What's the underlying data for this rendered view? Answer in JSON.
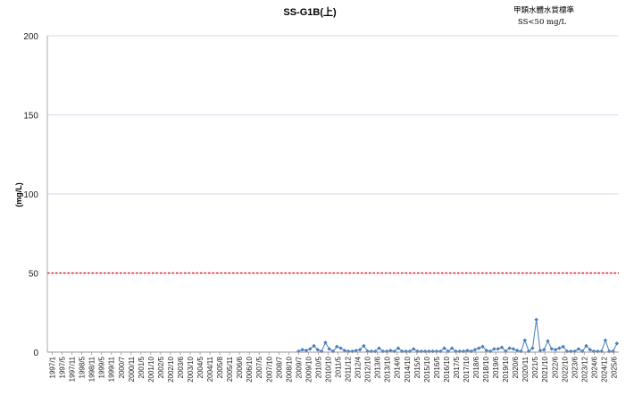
{
  "chart_data": {
    "type": "line",
    "title": "SS-G1B(上)",
    "standard_line1": "甲類水體水質標準",
    "standard_line2": "SS<50 mg/L",
    "xlabel": "",
    "ylabel": "(mg/L)",
    "ylim": [
      0,
      200
    ],
    "yticks": [
      0,
      50,
      100,
      150,
      200
    ],
    "grid": true,
    "legend": "none",
    "standard_value": 50,
    "standard_color": "#e02020",
    "series_color": "#4a7ebb",
    "grid_color": "#c8cde8",
    "x_ticks": [
      "1997/1",
      "1997/5",
      "1997/11",
      "1998/5",
      "1998/11",
      "1999/5",
      "1999/11",
      "2000/7",
      "2000/11",
      "2001/5",
      "2001/10",
      "2002/5",
      "2002/10",
      "2003/6",
      "2003/10",
      "2004/5",
      "2004/11",
      "2005/8",
      "2005/11",
      "2006/6",
      "2006/10",
      "2007/5",
      "2007/10",
      "2008/7",
      "2008/10",
      "2009/7",
      "2009/10",
      "2010/5",
      "2010/10",
      "2011/5",
      "2011/12",
      "2012/4",
      "2012/10",
      "2013/6",
      "2013/10",
      "2014/6",
      "2014/10",
      "2015/5",
      "2015/10",
      "2016/5",
      "2016/10",
      "2017/5",
      "2017/10",
      "2018/6",
      "2018/10",
      "2019/6",
      "2019/10",
      "2020/6",
      "2020/11",
      "2021/5",
      "2021/10",
      "2022/6",
      "2022/10",
      "2023/6",
      "2023/12",
      "2024/6",
      "2024/12",
      "2025/6"
    ],
    "values": [
      null,
      null,
      null,
      null,
      null,
      null,
      null,
      null,
      null,
      null,
      null,
      null,
      null,
      null,
      null,
      null,
      null,
      null,
      null,
      null,
      null,
      null,
      null,
      null,
      null,
      null,
      null,
      null,
      null,
      null,
      null,
      null,
      null,
      null,
      null,
      null,
      null,
      null,
      null,
      null,
      null,
      null,
      null,
      null,
      null,
      null,
      null,
      null,
      null,
      null,
      null,
      null,
      null,
      null,
      null,
      null,
      null,
      null,
      null,
      null,
      null,
      null,
      null,
      null,
      null,
      0.5,
      1.5,
      1.0,
      2.0,
      4.0,
      1.5,
      0.5,
      6.0,
      2.0,
      0.5,
      3.5,
      2.5,
      1.0,
      0.5,
      0.5,
      1.0,
      1.5,
      4.0,
      0.5,
      0.5,
      0.5,
      2.5,
      0.5,
      0.5,
      1.0,
      0.5,
      2.5,
      0.5,
      0.5,
      0.5,
      2.0,
      0.5,
      0.5,
      0.5,
      0.5,
      0.5,
      0.5,
      0.5,
      2.5,
      0.5,
      2.5,
      0.5,
      0.5,
      0.5,
      1.0,
      0.5,
      1.5,
      2.5,
      3.5,
      1.0,
      0.5,
      2.0,
      2.0,
      3.0,
      0.5,
      2.5,
      2.0,
      1.0,
      0.5,
      7.5,
      0.5,
      2.5,
      20.5,
      1.0,
      1.5,
      7.0,
      2.0,
      1.5,
      2.5,
      3.5,
      0.5,
      0.5,
      0.5,
      2.0,
      0.5,
      4.0,
      1.5,
      0.5,
      0.5,
      0.5,
      7.5,
      0.5,
      0.5,
      5.5
    ]
  }
}
